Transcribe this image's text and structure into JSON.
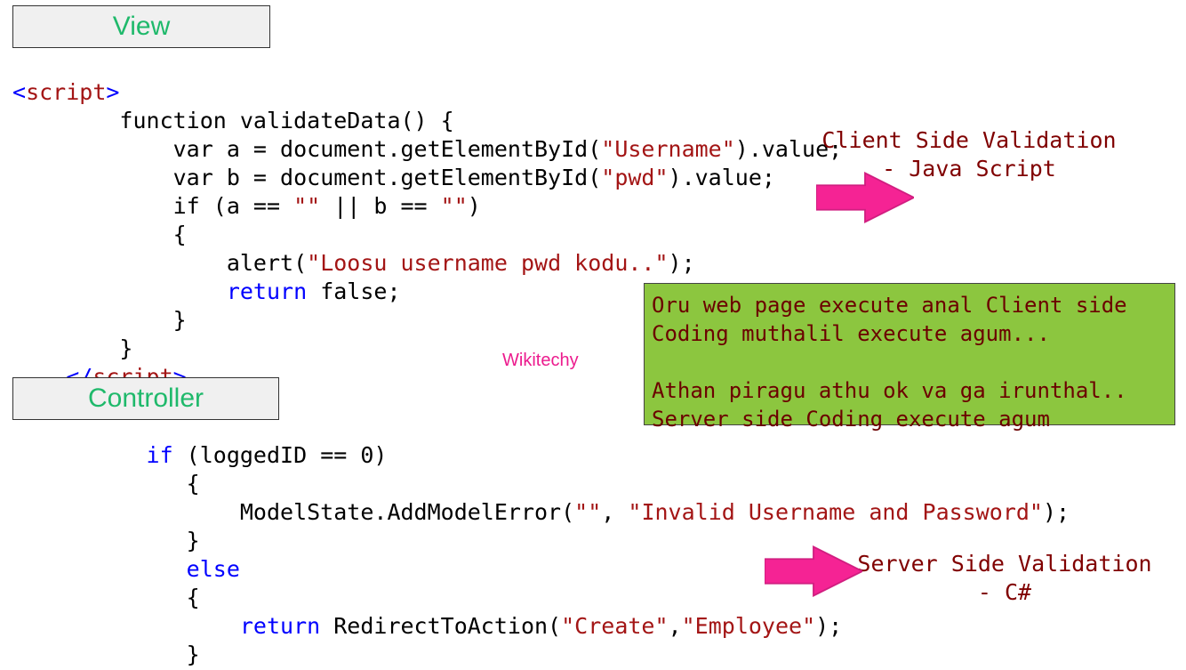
{
  "sections": {
    "view": "View",
    "controller": "Controller"
  },
  "view_code": {
    "open_tag_lt": "<",
    "script_word": "script",
    "open_tag_gt": ">",
    "func_sig": "function validateData() {",
    "var_a_pre": "var a = document.getElementById(",
    "var_a_str": "\"Username\"",
    "var_a_post": ").value;",
    "var_b_pre": "var b = document.getElementById(",
    "var_b_str": "\"pwd\"",
    "var_b_post": ").value;",
    "if_pre": "if (a == ",
    "if_s1": "\"\"",
    "if_mid": " || b == ",
    "if_s2": "\"\"",
    "if_post": ")",
    "brace_open": "{",
    "alert_pre": "alert(",
    "alert_str": "\"Loosu username pwd kodu..\"",
    "alert_post": ");",
    "return_kw": "return",
    "return_false": " false;",
    "brace_close": "}",
    "func_close": "}",
    "close_tag_lt": "</",
    "close_tag_gt": ">"
  },
  "controller_code": {
    "if_kw": "if",
    "if_cond": " (loggedID == 0)",
    "brace_open": "{",
    "ms_pre": "ModelState.AddModelError(",
    "ms_s1": "\"\"",
    "ms_comma": ", ",
    "ms_s2": "\"Invalid Username and Password\"",
    "ms_post": ");",
    "brace_close": "}",
    "else_kw": "else",
    "brace_open2": "{",
    "return_kw": "return",
    "rta_pre": " RedirectToAction(",
    "rta_s1": "\"Create\"",
    "rta_comma": ",",
    "rta_s2": "\"Employee\"",
    "rta_post": ");",
    "brace_close2": "}"
  },
  "annotations": {
    "client_line1": "Client Side Validation",
    "client_line2": "- Java Script",
    "server_line1": "Server Side Validation",
    "server_line2": "- C#"
  },
  "note": {
    "line1": "Oru web page execute anal Client side",
    "line2": "Coding muthalil execute agum...",
    "line3": "Athan piragu athu ok va ga irunthal..",
    "line4": "Server side Coding execute agum"
  },
  "watermark": "Wikitechy"
}
